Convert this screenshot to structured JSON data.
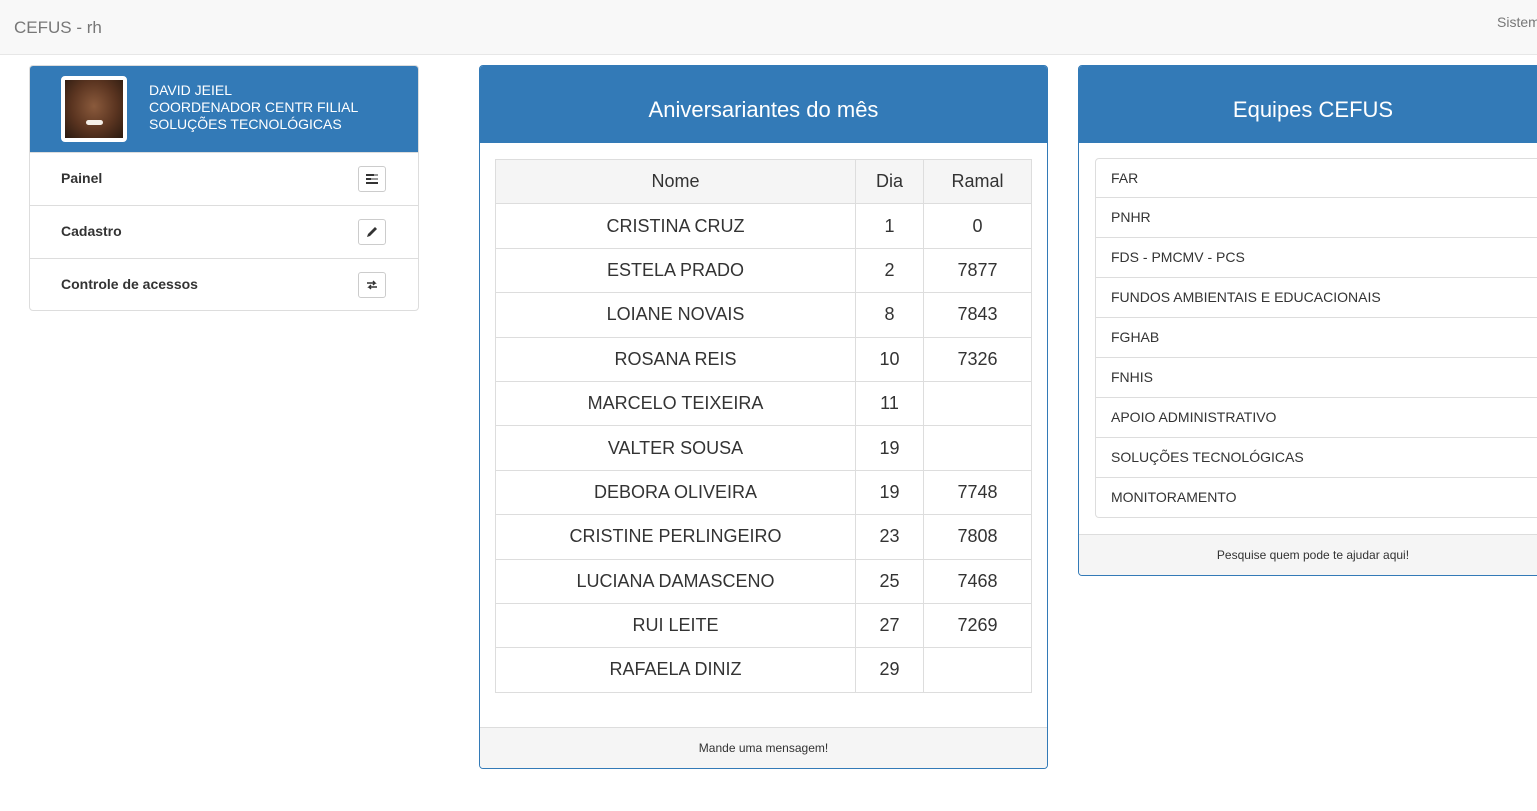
{
  "navbar": {
    "brand": "CEFUS - rh",
    "right_link": "Sistem"
  },
  "profile": {
    "name": "DAVID JEIEL",
    "role": "COORDENADOR CENTR FILIAL",
    "unit": "SOLUÇÕES TECNOLÓGICAS",
    "menu": [
      {
        "label": "Painel",
        "icon": "tasks-icon"
      },
      {
        "label": "Cadastro",
        "icon": "pencil-icon"
      },
      {
        "label": "Controle de acessos",
        "icon": "transfer-icon"
      }
    ]
  },
  "birthdays": {
    "title": "Aniversariantes do mês",
    "columns": [
      "Nome",
      "Dia",
      "Ramal"
    ],
    "rows": [
      [
        "CRISTINA CRUZ",
        "1",
        "0"
      ],
      [
        "ESTELA PRADO",
        "2",
        "7877"
      ],
      [
        "LOIANE NOVAIS",
        "8",
        "7843"
      ],
      [
        "ROSANA REIS",
        "10",
        "7326"
      ],
      [
        "MARCELO TEIXEIRA",
        "11",
        ""
      ],
      [
        "VALTER SOUSA",
        "19",
        ""
      ],
      [
        "DEBORA OLIVEIRA",
        "19",
        "7748"
      ],
      [
        "CRISTINE PERLINGEIRO",
        "23",
        "7808"
      ],
      [
        "LUCIANA DAMASCENO",
        "25",
        "7468"
      ],
      [
        "RUI LEITE",
        "27",
        "7269"
      ],
      [
        "RAFAELA DINIZ",
        "29",
        ""
      ]
    ],
    "footer": "Mande uma mensagem!"
  },
  "teams": {
    "title": "Equipes CEFUS",
    "items": [
      "FAR",
      "PNHR",
      "FDS - PMCMV - PCS",
      "FUNDOS AMBIENTAIS E EDUCACIONAIS",
      "FGHAB",
      "FNHIS",
      "APOIO ADMINISTRATIVO",
      "SOLUÇÕES TECNOLÓGICAS",
      "MONITORAMENTO"
    ],
    "footer": "Pesquise quem pode te ajudar aqui!"
  },
  "colors": {
    "primary": "#337ab7",
    "navbar_bg": "#f8f8f8",
    "border": "#dddddd"
  }
}
